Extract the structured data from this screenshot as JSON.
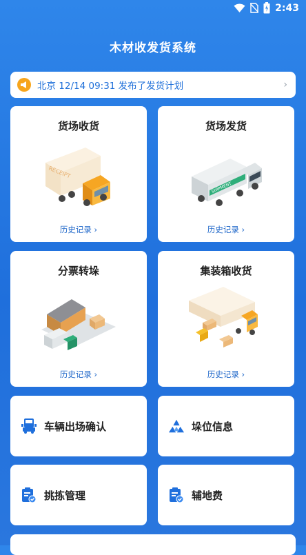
{
  "status_bar": {
    "time": "2:43",
    "icons": [
      "wifi-icon",
      "no-sim-icon",
      "battery-icon"
    ]
  },
  "header": {
    "title": "木材收发货系统"
  },
  "notice": {
    "icon": "megaphone-icon",
    "text": "北京 12/14 09:31 发布了发货计划",
    "arrow": "›"
  },
  "cards": [
    {
      "title": "货场收货",
      "history": "历史记录 ›",
      "truck_label": "RECEIPT"
    },
    {
      "title": "货场发货",
      "history": "历史记录 ›",
      "truck_label": "SHIPMENT"
    },
    {
      "title": "分票转垛",
      "history": "历史记录 ›"
    },
    {
      "title": "集装箱收货",
      "history": "历史记录 ›"
    }
  ],
  "menu": [
    {
      "label": "车辆出场确认",
      "icon": "truck-icon"
    },
    {
      "label": "垛位信息",
      "icon": "stack-icon"
    },
    {
      "label": "挑拣管理",
      "icon": "clipboard-check-icon"
    },
    {
      "label": "辅地费",
      "icon": "clipboard-check-icon"
    }
  ],
  "colors": {
    "primary": "#1f6fdc",
    "accent": "#f7a51c",
    "link": "#1f67c9"
  }
}
